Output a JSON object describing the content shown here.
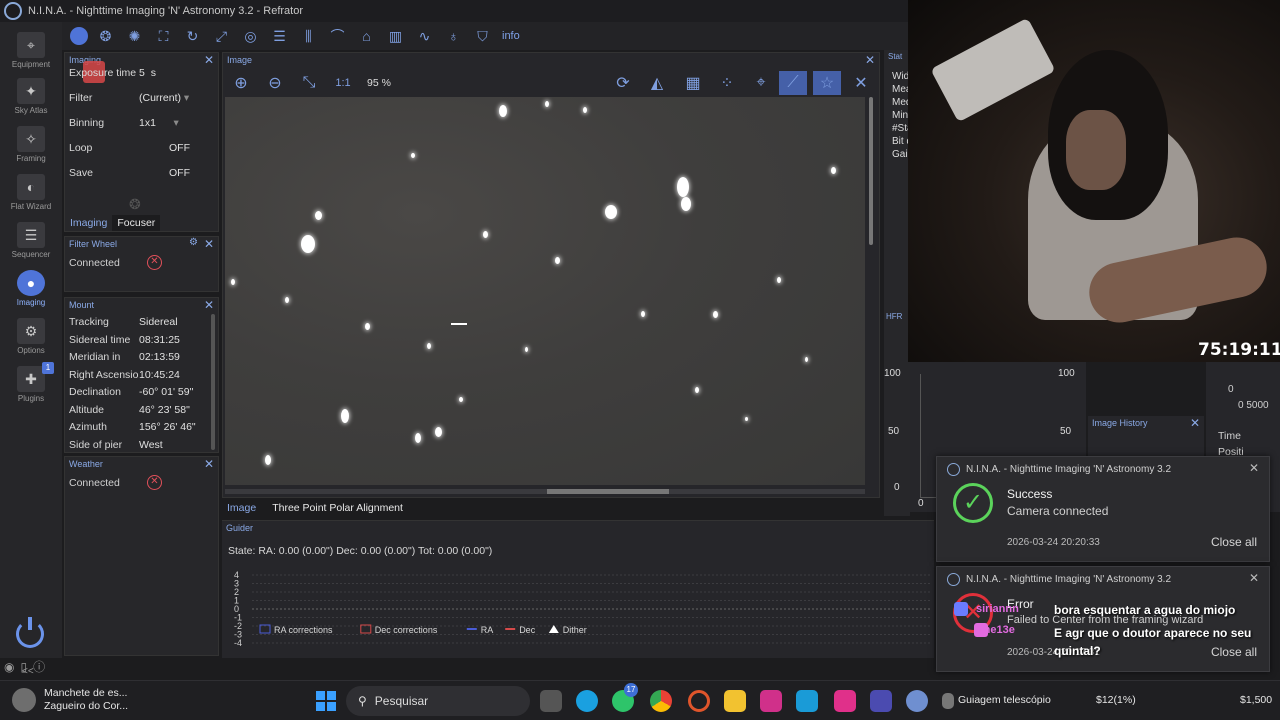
{
  "window": {
    "title": "N.I.N.A. - Nighttime Imaging 'N' Astronomy 3.2   -   Refrator"
  },
  "sidebar": {
    "items": [
      {
        "label": "Equipment",
        "icon": "camera-icon"
      },
      {
        "label": "Sky Atlas",
        "icon": "atlas-icon"
      },
      {
        "label": "Framing",
        "icon": "framing-icon"
      },
      {
        "label": "Flat Wizard",
        "icon": "flat-icon"
      },
      {
        "label": "Sequencer",
        "icon": "sequencer-icon"
      },
      {
        "label": "Imaging",
        "icon": "imaging-icon"
      },
      {
        "label": "Options",
        "icon": "gear-icon"
      },
      {
        "label": "Plugins",
        "icon": "puzzle-icon"
      }
    ],
    "plugins_badge": "1",
    "collapse": "<<"
  },
  "toolbar": {
    "info_label": "info"
  },
  "imaging": {
    "title": "Imaging",
    "rows": [
      {
        "k": "Exposure time",
        "v": "5",
        "unit": "s"
      },
      {
        "k": "Filter",
        "v": "(Current)"
      },
      {
        "k": "Binning",
        "v": "1x1"
      },
      {
        "k": "Loop",
        "v": "OFF"
      },
      {
        "k": "Save",
        "v": "OFF"
      }
    ],
    "tabs": [
      "Imaging",
      "Focuser"
    ]
  },
  "filterwheel": {
    "title": "Filter Wheel",
    "status": "Connected"
  },
  "mount": {
    "title": "Mount",
    "rows": [
      {
        "k": "Tracking",
        "v": "Sidereal"
      },
      {
        "k": "Sidereal time",
        "v": "08:31:25"
      },
      {
        "k": "Meridian in",
        "v": "02:13:59"
      },
      {
        "k": "Right Ascension",
        "v": "10:45:24"
      },
      {
        "k": "Declination",
        "v": "-60° 01' 59\""
      },
      {
        "k": "Altitude",
        "v": "46° 23' 58\""
      },
      {
        "k": "Azimuth",
        "v": "156° 26' 46\""
      },
      {
        "k": "Side of pier",
        "v": "West"
      }
    ]
  },
  "weather": {
    "title": "Weather",
    "status": "Connected"
  },
  "image": {
    "title": "Image",
    "zoom_ratio": "1:1",
    "zoom_percent": "95 %"
  },
  "image_tabs": [
    "Image",
    "Three Point Polar Alignment"
  ],
  "guider": {
    "title": "Guider",
    "state": "State:  RA: 0.00 (0.00\")  Dec: 0.00 (0.00\")  Tot: 0.00 (0.00\")",
    "y_ticks": [
      "4",
      "3",
      "2",
      "1",
      "0",
      "-1",
      "-2",
      "-3",
      "-4"
    ],
    "legend": [
      "RA corrections",
      "Dec corrections",
      "RA",
      "Dec",
      "Dither"
    ],
    "colors": {
      "ra": "#4a5cd6",
      "dec": "#d64a4a"
    }
  },
  "statistics": {
    "title": "Statistics",
    "lines": [
      "Width",
      "Mean",
      "Median",
      "Min",
      "#Stars",
      "Bit depth",
      "Gain"
    ]
  },
  "hfr": {
    "title": "HFR History",
    "y_left": [
      "100",
      "50",
      "0"
    ],
    "y_right": [
      "100",
      "50",
      "0"
    ],
    "right_zero": "0"
  },
  "image_history": {
    "title": "Image History"
  },
  "time_col": {
    "label": "Time",
    "sub": "Positi",
    "zero": "0",
    "ticks": "0 5000"
  },
  "timer": "75:19:11",
  "notifications": [
    {
      "app": "N.I.N.A. - Nighttime Imaging 'N' Astronomy 3.2",
      "title": "Success",
      "body": "Camera connected",
      "date": "2026-03-24 20:20:33",
      "action": "Close all"
    },
    {
      "app": "N.I.N.A. - Nighttime Imaging 'N' Astronomy 3.2",
      "title": "Error",
      "body": "Failed to Center from the framing wizard",
      "date": "2026-03-24 20:17:31",
      "action": "Close all"
    }
  ],
  "chat": [
    {
      "name": "siriannn",
      "text": "bora esquentar a agua do miojo"
    },
    {
      "name": "the13e",
      "text": "E agr que o doutor aparece no seu quintal?"
    }
  ],
  "taskbar": {
    "news_title": "Manchete de es...",
    "news_sub": "Zagueiro do Cor...",
    "search": "Pesquisar",
    "whatsapp_badge": "17",
    "active_window": "Guiagem telescópio",
    "stock": "$12(1%)",
    "stock2": "$1,500"
  }
}
